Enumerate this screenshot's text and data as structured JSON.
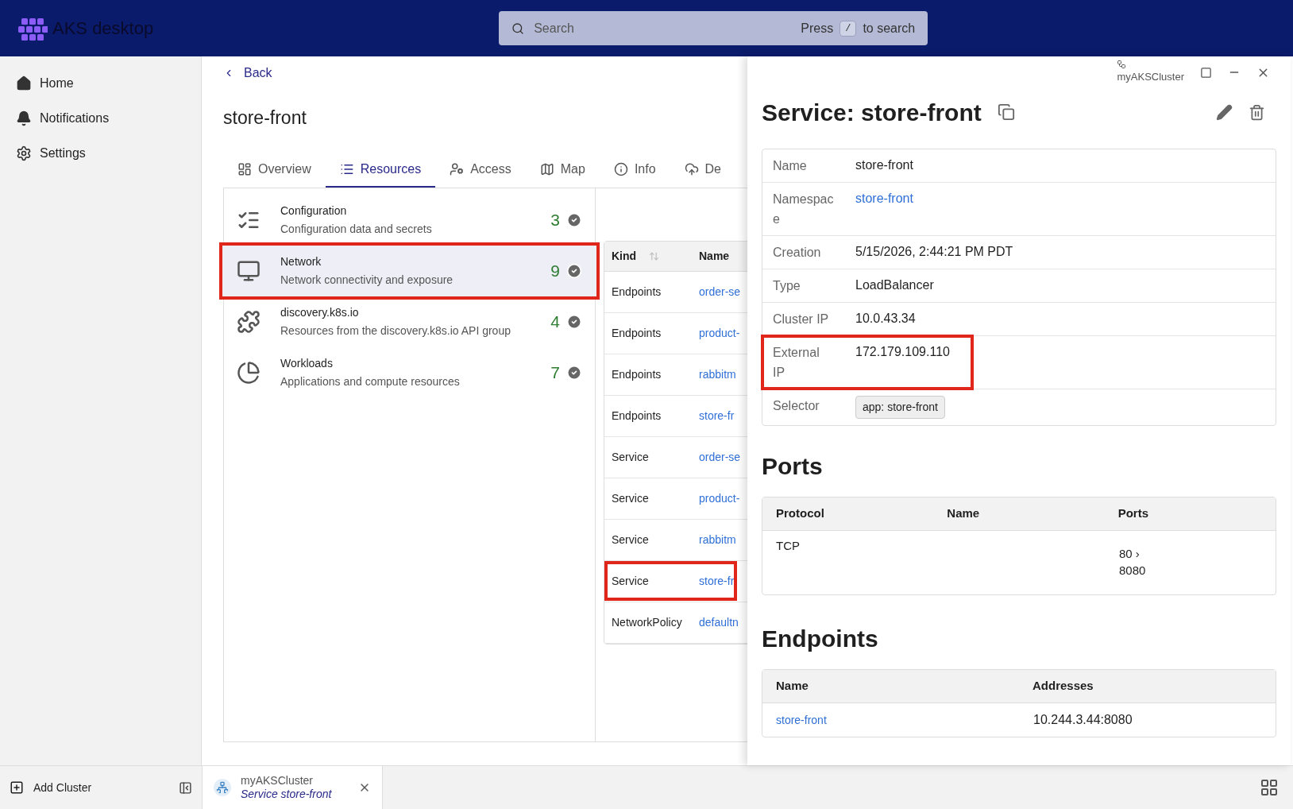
{
  "app": {
    "title": "AKS desktop"
  },
  "search": {
    "placeholder": "Search",
    "hint_before": "Press",
    "key": "/",
    "hint_after": "to search"
  },
  "sidebar": {
    "items": [
      {
        "label": "Home",
        "kind": "home"
      },
      {
        "label": "Notifications",
        "kind": "bell"
      },
      {
        "label": "Settings",
        "kind": "gear"
      }
    ],
    "add_cluster": "Add Cluster"
  },
  "page": {
    "back": "Back",
    "title": "store-front",
    "tabs": [
      {
        "label": "Overview",
        "kind": "overview",
        "selected": false
      },
      {
        "label": "Resources",
        "kind": "list",
        "selected": true
      },
      {
        "label": "Access",
        "kind": "access",
        "selected": false
      },
      {
        "label": "Map",
        "kind": "map",
        "selected": false
      },
      {
        "label": "Info",
        "kind": "info",
        "selected": false
      },
      {
        "label": "De",
        "kind": "cloud",
        "selected": false
      }
    ],
    "categories": [
      {
        "title": "Configuration",
        "subtitle": "Configuration data and secrets",
        "count": "3",
        "kind": "config",
        "highlighted": false
      },
      {
        "title": "Network",
        "subtitle": "Network connectivity and exposure",
        "count": "9",
        "kind": "network",
        "highlighted": true
      },
      {
        "title": "discovery.k8s.io",
        "subtitle": "Resources from the discovery.k8s.io API group",
        "count": "4",
        "kind": "puzzle",
        "highlighted": false
      },
      {
        "title": "Workloads",
        "subtitle": "Applications and compute resources",
        "count": "7",
        "kind": "pie",
        "highlighted": false
      }
    ],
    "table": {
      "columns": [
        "Kind",
        "Name"
      ],
      "rows": [
        {
          "kind": "Endpoints",
          "name": "order-se",
          "highlighted": false
        },
        {
          "kind": "Endpoints",
          "name": "product-",
          "highlighted": false
        },
        {
          "kind": "Endpoints",
          "name": "rabbitm",
          "highlighted": false
        },
        {
          "kind": "Endpoints",
          "name": "store-fr",
          "highlighted": false
        },
        {
          "kind": "Service",
          "name": "order-se",
          "highlighted": false
        },
        {
          "kind": "Service",
          "name": "product-",
          "highlighted": false
        },
        {
          "kind": "Service",
          "name": "rabbitm",
          "highlighted": false
        },
        {
          "kind": "Service",
          "name": "store-fr",
          "highlighted": true
        },
        {
          "kind": "NetworkPolicy",
          "name": "defaultn",
          "highlighted": false
        }
      ]
    }
  },
  "panel": {
    "cluster": "myAKSCluster",
    "title": "Service: store-front",
    "fields": [
      {
        "label": "Name",
        "value": "store-front",
        "kind": "text",
        "highlighted": false
      },
      {
        "label": "Namespace",
        "value": "store-front",
        "kind": "link",
        "highlighted": false
      },
      {
        "label": "Creation",
        "value": "5/15/2026, 2:44:21 PM PDT",
        "kind": "text",
        "highlighted": false
      },
      {
        "label": "Type",
        "value": "LoadBalancer",
        "kind": "text",
        "highlighted": false
      },
      {
        "label": "Cluster IP",
        "value": "10.0.43.34",
        "kind": "text",
        "highlighted": false
      },
      {
        "label": "External IP",
        "value": "172.179.109.110",
        "kind": "text",
        "highlighted": true
      },
      {
        "label": "Selector",
        "value": "app: store-front",
        "kind": "chip",
        "highlighted": false
      }
    ],
    "ports": {
      "heading": "Ports",
      "columns": [
        "Protocol",
        "Name",
        "Ports"
      ],
      "rows": [
        {
          "protocol": "TCP",
          "ports": "80 › 8080"
        }
      ]
    },
    "endpoints": {
      "heading": "Endpoints",
      "columns": [
        "Name",
        "Addresses"
      ],
      "rows": [
        {
          "name": "store-front",
          "addresses": "10.244.3.44:8080"
        }
      ]
    }
  },
  "bottom_tab": {
    "cluster": "myAKSCluster",
    "label": "Service store-front"
  }
}
